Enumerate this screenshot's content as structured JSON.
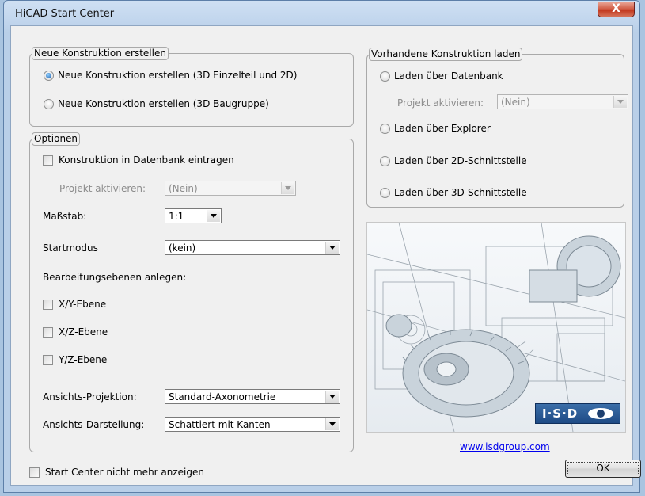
{
  "window": {
    "title": "HiCAD Start Center",
    "close_label": "X"
  },
  "new_construction": {
    "legend": "Neue Konstruktion erstellen",
    "option_3d_part": "Neue Konstruktion erstellen (3D Einzelteil und 2D)",
    "option_3d_assembly": "Neue Konstruktion erstellen (3D Baugruppe)",
    "selected": "option_3d_part"
  },
  "load_construction": {
    "legend": "Vorhandene Konstruktion laden",
    "via_database": "Laden über Datenbank",
    "project_label": "Projekt aktivieren:",
    "project_value": "(Nein)",
    "via_explorer": "Laden über Explorer",
    "via_2d_interface": "Laden über 2D-Schnittstelle",
    "via_3d_interface": "Laden über 3D-Schnittstelle"
  },
  "options": {
    "legend": "Optionen",
    "register_in_db": "Konstruktion in Datenbank eintragen",
    "project_label": "Projekt aktivieren:",
    "project_value": "(Nein)",
    "scale_label": "Maßstab:",
    "scale_value": "1:1",
    "start_mode_label": "Startmodus",
    "start_mode_value": "(kein)",
    "planes_heading": "Bearbeitungsebenen anlegen:",
    "plane_xy": "X/Y-Ebene",
    "plane_xz": "X/Z-Ebene",
    "plane_yz": "Y/Z-Ebene",
    "projection_label": "Ansichts-Projektion:",
    "projection_value": "Standard-Axonometrie",
    "display_label": "Ansichts-Darstellung:",
    "display_value": "Schattiert mit Kanten"
  },
  "footer": {
    "dont_show_again": "Start Center nicht mehr anzeigen",
    "website": "www.isdgroup.com",
    "ok_label": "OK"
  },
  "branding": {
    "logo_text": "I·S·D"
  }
}
